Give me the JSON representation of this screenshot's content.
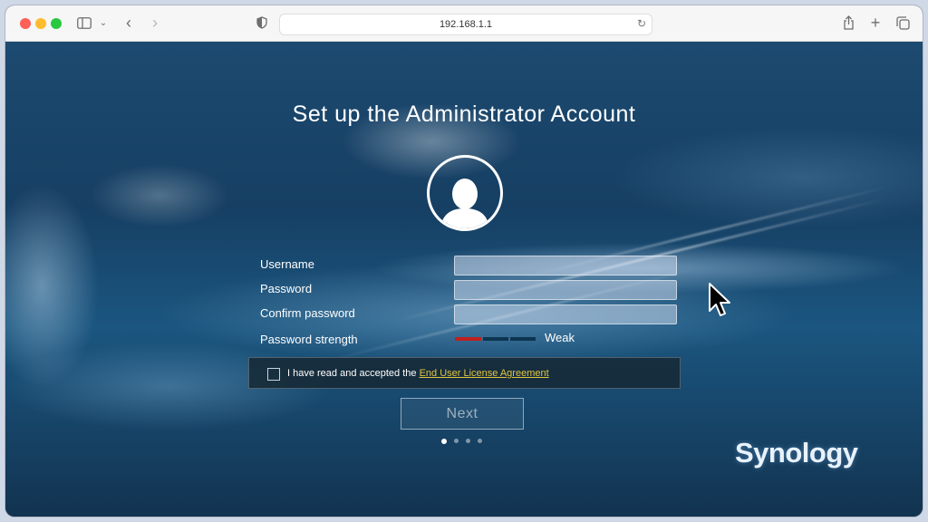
{
  "browser": {
    "url": "192.168.1.1"
  },
  "page": {
    "title": "Set up the Administrator Account",
    "labels": {
      "username": "Username",
      "password": "Password",
      "confirm_password": "Confirm password",
      "password_strength": "Password strength"
    },
    "strength": {
      "value": "Weak",
      "filled_segments": 1,
      "total_segments": 3,
      "color": "#c0201e"
    },
    "agreement": {
      "text": "I have read and accepted the ",
      "link": "End User License Agreement",
      "checked": false
    },
    "next_button": "Next",
    "steps": {
      "current": 1,
      "total": 4
    },
    "logo": "Synology"
  }
}
